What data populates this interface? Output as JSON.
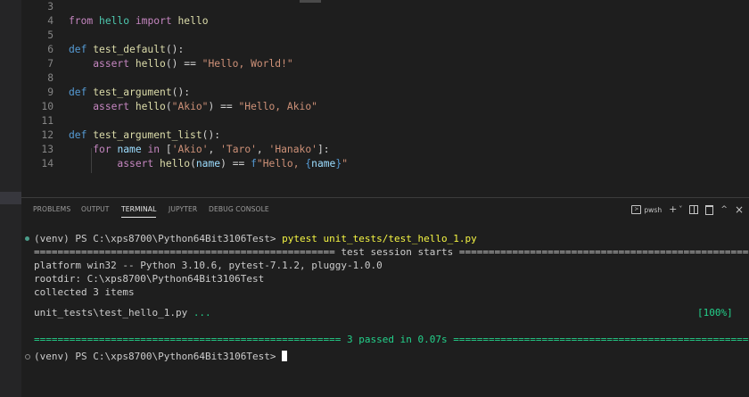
{
  "editor": {
    "lines": [
      {
        "num": "3",
        "tokens": []
      },
      {
        "num": "4",
        "tokens": [
          [
            "kw",
            "from"
          ],
          [
            "txt",
            " "
          ],
          [
            "mod",
            "hello"
          ],
          [
            "txt",
            " "
          ],
          [
            "kw",
            "import"
          ],
          [
            "txt",
            " "
          ],
          [
            "fn",
            "hello"
          ]
        ]
      },
      {
        "num": "5",
        "tokens": []
      },
      {
        "num": "6",
        "tokens": [
          [
            "def",
            "def"
          ],
          [
            "txt",
            " "
          ],
          [
            "fn",
            "test_default"
          ],
          [
            "txt",
            "():"
          ]
        ]
      },
      {
        "num": "7",
        "tokens": [
          [
            "txt",
            "    "
          ],
          [
            "kw",
            "assert"
          ],
          [
            "txt",
            " "
          ],
          [
            "fn",
            "hello"
          ],
          [
            "txt",
            "() == "
          ],
          [
            "str",
            "\"Hello, World!\""
          ]
        ]
      },
      {
        "num": "8",
        "tokens": []
      },
      {
        "num": "9",
        "tokens": [
          [
            "def",
            "def"
          ],
          [
            "txt",
            " "
          ],
          [
            "fn",
            "test_argument"
          ],
          [
            "txt",
            "():"
          ]
        ]
      },
      {
        "num": "10",
        "tokens": [
          [
            "txt",
            "    "
          ],
          [
            "kw",
            "assert"
          ],
          [
            "txt",
            " "
          ],
          [
            "fn",
            "hello"
          ],
          [
            "txt",
            "("
          ],
          [
            "str",
            "\"Akio\""
          ],
          [
            "txt",
            ") == "
          ],
          [
            "str",
            "\"Hello, Akio\""
          ]
        ]
      },
      {
        "num": "11",
        "tokens": []
      },
      {
        "num": "12",
        "tokens": [
          [
            "def",
            "def"
          ],
          [
            "txt",
            " "
          ],
          [
            "fn",
            "test_argument_list"
          ],
          [
            "txt",
            "():"
          ]
        ]
      },
      {
        "num": "13",
        "tokens": [
          [
            "txt",
            "    "
          ],
          [
            "kw",
            "for"
          ],
          [
            "txt",
            " "
          ],
          [
            "var",
            "name"
          ],
          [
            "txt",
            " "
          ],
          [
            "kw",
            "in"
          ],
          [
            "txt",
            " ["
          ],
          [
            "str",
            "'Akio'"
          ],
          [
            "txt",
            ", "
          ],
          [
            "str",
            "'Taro'"
          ],
          [
            "txt",
            ", "
          ],
          [
            "str",
            "'Hanako'"
          ],
          [
            "txt",
            "]:"
          ]
        ]
      },
      {
        "num": "14",
        "tokens": [
          [
            "txt",
            "        "
          ],
          [
            "kw",
            "assert"
          ],
          [
            "txt",
            " "
          ],
          [
            "fn",
            "hello"
          ],
          [
            "txt",
            "("
          ],
          [
            "var",
            "name"
          ],
          [
            "txt",
            ") == "
          ],
          [
            "def",
            "f"
          ],
          [
            "str",
            "\"Hello, "
          ],
          [
            "brace",
            "{"
          ],
          [
            "var",
            "name"
          ],
          [
            "brace",
            "}"
          ],
          [
            "str",
            "\""
          ]
        ]
      }
    ]
  },
  "panel": {
    "tabs": [
      "PROBLEMS",
      "OUTPUT",
      "TERMINAL",
      "JUPYTER",
      "DEBUG CONSOLE"
    ],
    "active_tab": "TERMINAL",
    "shell_name": "pwsh",
    "new_terminal_label": "+",
    "dropdown_label": "˅",
    "more_label": "···",
    "maximize_label": "^",
    "close_label": "×"
  },
  "terminal": {
    "prompt1": "(venv) PS C:\\xps8700\\Python64Bit3106Test> ",
    "command": "pytest unit_tests/test_hello_1.py",
    "session_header": "=================================================== test session starts ====================================================",
    "platform": "platform win32 -- Python 3.10.6, pytest-7.1.2, pluggy-1.0.0",
    "rootdir": "rootdir: C:\\xps8700\\Python64Bit3106Test",
    "collected": "collected 3 items",
    "test_file": "unit_tests\\test_hello_1.py ",
    "test_dots": "...",
    "percent": "[100%]",
    "summary_left": "==================================================== ",
    "summary_mid": "3 passed in 0.07s",
    "summary_right": " ========================================================",
    "prompt2": "(venv) PS C:\\xps8700\\Python64Bit3106Test> "
  },
  "colors": {
    "keyword": "#c586c0",
    "function": "#dcdcaa",
    "string": "#ce9178",
    "pass_green": "#23d18b",
    "command_yellow": "#f5f543"
  }
}
